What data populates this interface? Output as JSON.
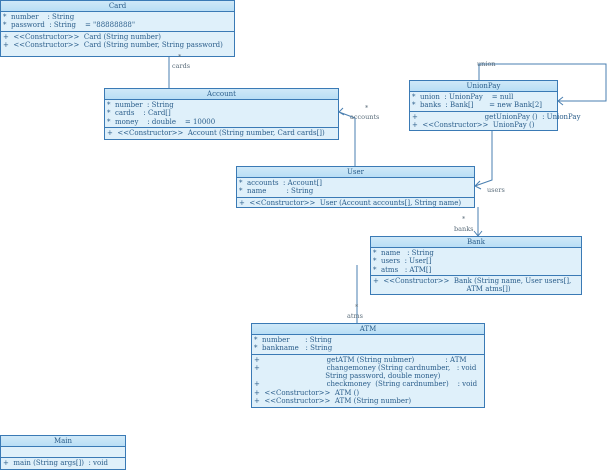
{
  "classes": {
    "card": {
      "name": "Card",
      "attributes": [
        "*  number    : String",
        "*  password  : String    = \"88888888\""
      ],
      "operations": [
        "+  <<Constructor>>  Card (String number)",
        "+  <<Constructor>>  Card (String number, String password)"
      ]
    },
    "account": {
      "name": "Account",
      "attributes": [
        "*  number  : String",
        "*  cards    : Card[]",
        "*  money    : double    = 10000"
      ],
      "operations": [
        "+  <<Constructor>>  Account (String number, Card cards[])"
      ]
    },
    "unionpay": {
      "name": "UnionPay",
      "attributes": [
        "*  union  : UnionPay    = null",
        "*  banks  : Bank[]       = new Bank[2]"
      ],
      "operations": [
        "+                              getUnionPay ()  : UnionPay",
        "+  <<Constructor>>  UnionPay ()"
      ]
    },
    "user": {
      "name": "User",
      "attributes": [
        "*  accounts  : Account[]",
        "*  name         : String"
      ],
      "operations": [
        "+  <<Constructor>>  User (Account accounts[], String name)"
      ]
    },
    "bank": {
      "name": "Bank",
      "attributes": [
        "*  name   : String",
        "*  users  : User[]",
        "*  atms   : ATM[]"
      ],
      "operations": [
        "+  <<Constructor>>  Bank (String name, User users[],",
        "                                          ATM atms[])"
      ]
    },
    "atm": {
      "name": "ATM",
      "attributes": [
        "*  number       : String",
        "*  bankname   : String"
      ],
      "operations": [
        "+                              getATM (String nubmer)              : ATM",
        "+                              changemoney (String cardnumber,   : void",
        "                                String password, double money)",
        "+                              checkmoney  (String cardnumber)    : void",
        "+  <<Constructor>>  ATM ()",
        "+  <<Constructor>>  ATM (String number)"
      ]
    },
    "main": {
      "name": "Main",
      "attributes": [],
      "operations": [
        "+  main (String args[])  : void"
      ]
    }
  },
  "associations": {
    "account_card": {
      "multiplicity": "*",
      "role": "cards"
    },
    "user_account": {
      "multiplicity": "*",
      "role": "accounts"
    },
    "unionpay_self": {
      "role": "union"
    },
    "unionpay_users": {
      "role": "users"
    },
    "user_bank": {
      "multiplicity": "*",
      "role": "banks"
    },
    "bank_atm": {
      "multiplicity": "*",
      "role": "atms"
    }
  },
  "colors": {
    "border": "#3a7ab5",
    "fill": "#dff0fa",
    "text": "#2a5d8a",
    "line": "#4a7fb0"
  }
}
